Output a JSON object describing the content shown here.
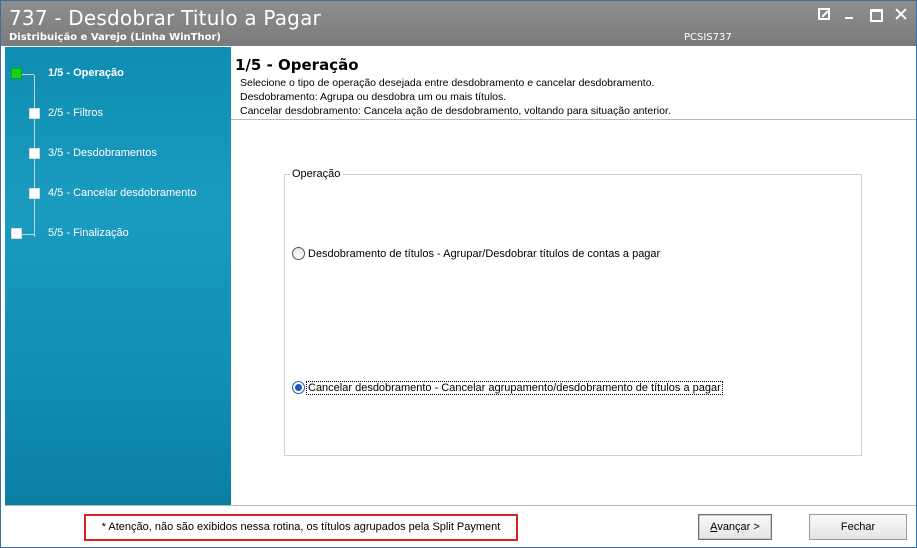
{
  "window": {
    "title": "737 - Desdobrar Titulo a Pagar",
    "subtitle": "Distribuição e Varejo (Linha WinThor)",
    "code": "PCSIS737"
  },
  "sidebar": {
    "steps": [
      {
        "label": "1/5 - Operação",
        "active": true
      },
      {
        "label": "2/5 - Filtros",
        "active": false
      },
      {
        "label": "3/5 - Desdobramentos",
        "active": false
      },
      {
        "label": "4/5 - Cancelar desdobramento",
        "active": false
      },
      {
        "label": "5/5 - Finalização",
        "active": false
      }
    ]
  },
  "header": {
    "title": "1/5 - Operação",
    "lines": [
      "Selecione o tipo de operação desejada entre desdobramento e cancelar desdobramento.",
      "Desdobramento: Agrupa ou desdobra um ou mais títulos.",
      "Cancelar desdobramento: Cancela ação de desdobramento, voltando para situação anterior."
    ]
  },
  "operation": {
    "group_title": "Operação",
    "options": [
      {
        "label": "Desdobramento de títulos - Agrupar/Desdobrar títulos de contas a pagar",
        "checked": false
      },
      {
        "label": "Cancelar desdobramento - Cancelar agrupamento/desdobramento de títulos a pagar",
        "checked": true
      }
    ]
  },
  "footer": {
    "notice": "* Atenção, não são exibidos nessa rotina, os títulos agrupados pela Split Payment",
    "next_label_prefix": "A",
    "next_label_rest": "vançar >",
    "close_label": "Fechar"
  },
  "colors": {
    "sidebar_accent": "#1a9bc0",
    "active_step": "#17d117",
    "notice_border": "#e02020",
    "titlebar": "#8e8e8e"
  }
}
